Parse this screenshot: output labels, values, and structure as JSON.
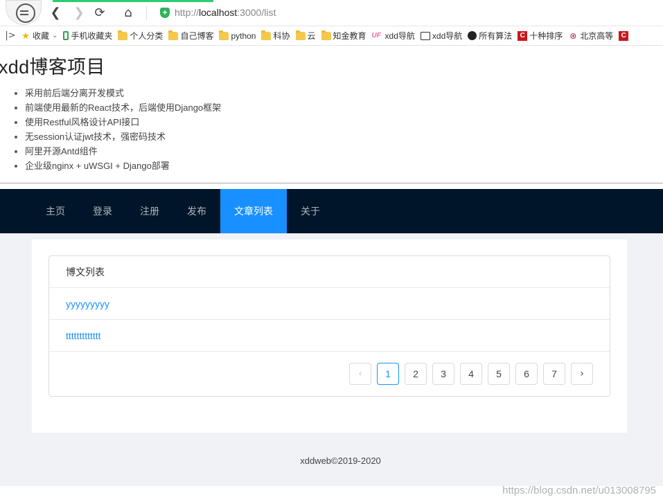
{
  "browser": {
    "url_prefix": "http://",
    "url_host": "localhost",
    "url_rest": ":3000/list",
    "back_icon": "chevron-left-icon",
    "forward_icon": "chevron-right-icon",
    "reload_icon": "reload-icon",
    "home_icon": "home-icon",
    "security_icon": "shield-icon"
  },
  "bookmarks": [
    {
      "label": "收藏",
      "icon": "star-icon"
    },
    {
      "label": "手机收藏夹",
      "icon": "phone-icon"
    },
    {
      "label": "个人分类",
      "icon": "folder-icon"
    },
    {
      "label": "自己博客",
      "icon": "folder-icon"
    },
    {
      "label": "python",
      "icon": "folder-icon"
    },
    {
      "label": "科协",
      "icon": "folder-icon"
    },
    {
      "label": "云",
      "icon": "folder-icon"
    },
    {
      "label": "知金教育",
      "icon": "folder-icon"
    },
    {
      "label": "xdd导航",
      "icon": "uf-icon"
    },
    {
      "label": "xdd导航",
      "icon": "book-icon"
    },
    {
      "label": "所有算法",
      "icon": "github-icon"
    },
    {
      "label": "十种排序",
      "icon": "csdn-icon"
    },
    {
      "label": "北京高等",
      "icon": "pku-icon"
    }
  ],
  "header": {
    "title": "xdd博客项目",
    "features": [
      "采用前后端分离开发模式",
      "前端使用最新的React技术，后端使用Django框架",
      "使用Restful风格设计API接口",
      "无session认证jwt技术，强密码技术",
      "阿里开源Antd组件",
      "企业级nginx + uWSGI + Django部署"
    ]
  },
  "menu": {
    "items": [
      "主页",
      "登录",
      "注册",
      "发布",
      "文章列表",
      "关于"
    ],
    "active": "文章列表"
  },
  "list": {
    "header": "博文列表",
    "items": [
      "yyyyyyyyy",
      "ttttttttttttt"
    ]
  },
  "pagination": {
    "prev_icon": "chevron-left-icon",
    "next_icon": "chevron-right-icon",
    "pages": [
      "1",
      "2",
      "3",
      "4",
      "5",
      "6",
      "7"
    ],
    "current": "1"
  },
  "footer": {
    "text": "xddweb©2019-2020"
  },
  "watermark": "https://blog.csdn.net/u013008795",
  "colors": {
    "menu_bg": "#001529",
    "primary": "#1890ff",
    "content_bg": "#f0f2f5"
  }
}
